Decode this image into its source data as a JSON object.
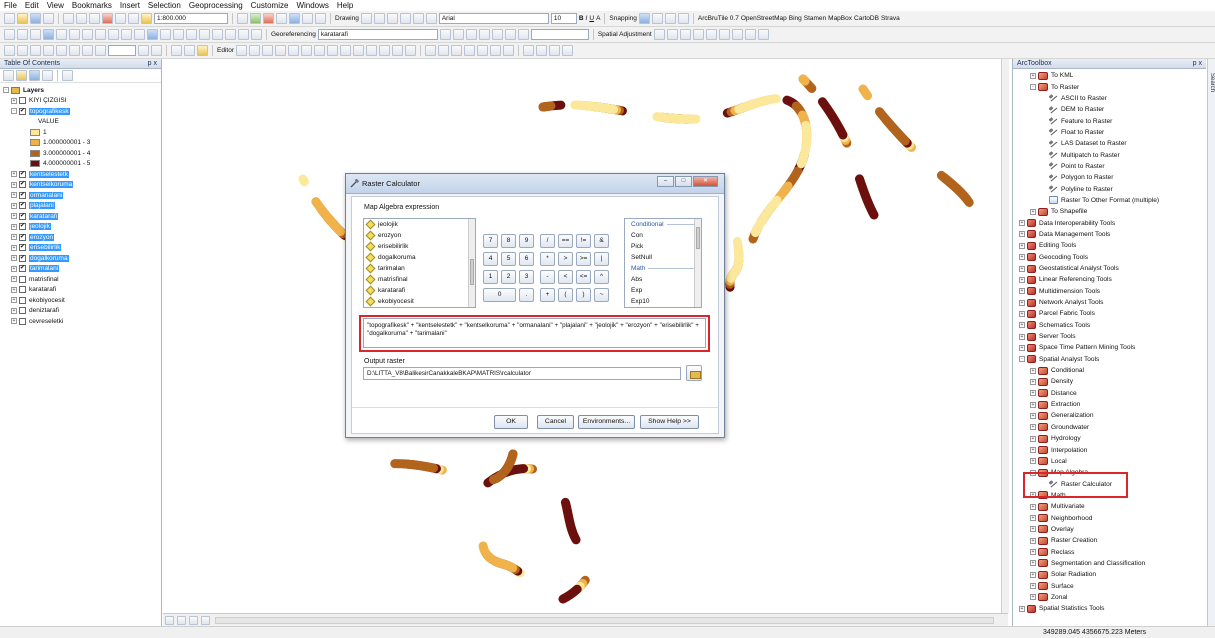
{
  "menu": [
    "File",
    "Edit",
    "View",
    "Bookmarks",
    "Insert",
    "Selection",
    "Geoprocessing",
    "Customize",
    "Windows",
    "Help"
  ],
  "toolbar": {
    "scale": "1:800.000",
    "drawing": "Drawing",
    "font": "Arial",
    "font_size": "10",
    "bold": "B",
    "italic": "I",
    "underline": "U",
    "text_color": "A",
    "snapping": "Snapping",
    "plugins": "ArcBruTile 0.7",
    "basemaps": [
      "OpenStreetMap",
      "Bing",
      "Stamen",
      "MapBox",
      "CartoDB",
      "Strava"
    ],
    "georeferencing": "Georeferencing",
    "georef_layer": "karatarafi",
    "spatial_adjustment": "Spatial Adjustment",
    "editor": "Editor"
  },
  "toc": {
    "title": "Table Of Contents",
    "pin": "p x",
    "root": "Layers",
    "layers": [
      {
        "name": "KIYI ÇIZGISI",
        "checked": false,
        "selected": false
      },
      {
        "name": "topografikesk",
        "checked": true,
        "selected": true
      },
      {
        "name": "kentselestetk",
        "checked": true,
        "selected": true
      },
      {
        "name": "kentselkoruma",
        "checked": true,
        "selected": true
      },
      {
        "name": "ormanalani",
        "checked": true,
        "selected": true
      },
      {
        "name": "plajalani",
        "checked": true,
        "selected": true
      },
      {
        "name": "karatarafi",
        "checked": true,
        "selected": true
      },
      {
        "name": "jeolojik",
        "checked": true,
        "selected": true
      },
      {
        "name": "erozyon",
        "checked": true,
        "selected": true
      },
      {
        "name": "erisebilirlik",
        "checked": true,
        "selected": true
      },
      {
        "name": "dogalkoruma",
        "checked": true,
        "selected": true
      },
      {
        "name": "tarimalani",
        "checked": true,
        "selected": true
      },
      {
        "name": "matrisfinal",
        "checked": false,
        "selected": false
      },
      {
        "name": "karatarafi",
        "checked": false,
        "selected": false
      },
      {
        "name": "ekobiyocesit",
        "checked": false,
        "selected": false
      },
      {
        "name": "deniztarafi",
        "checked": false,
        "selected": false
      },
      {
        "name": "cevreseletki",
        "checked": false,
        "selected": false
      }
    ],
    "legend_title": "VALUE",
    "legend": [
      {
        "label": "1",
        "color": "#fbe89a"
      },
      {
        "label": "1.000000001 - 3",
        "color": "#f0b24a"
      },
      {
        "label": "3.000000001 - 4",
        "color": "#b2631c"
      },
      {
        "label": "4.000000001 - 5",
        "color": "#6b0f0f"
      }
    ]
  },
  "dialog": {
    "title": "Raster Calculator",
    "win_min": "–",
    "win_max": "□",
    "win_close": "✕",
    "section_label": "Map Algebra expression",
    "layers": [
      "jeolojik",
      "erozyon",
      "erisebilirlik",
      "dogalkoruma",
      "tarimalan",
      "matrisfinal",
      "karatarafi",
      "ekobiyocesit"
    ],
    "keypad": [
      [
        "7",
        "8",
        "9",
        "/",
        "==",
        "!=",
        "&"
      ],
      [
        "4",
        "5",
        "6",
        "*",
        ">",
        ">=",
        "|"
      ],
      [
        "1",
        "2",
        "3",
        "-",
        "<",
        "<=",
        "^"
      ],
      [
        "0",
        ".",
        "+",
        "(",
        ")",
        "~"
      ]
    ],
    "func_group1": "Conditional",
    "func_items1": [
      "Con",
      "Pick",
      "SetNull"
    ],
    "func_group2": "Math",
    "func_items2": [
      "Abs",
      "Exp",
      "Exp10"
    ],
    "expression": "\"topografikesk\" + \"kentselestetk\" + \"kentselkoruma\" + \"ormanalani\" + \"plajalani\" + \"jeolojik\" + \"erozyon\" + \"erisebilirlik\" + \"dogalkoruma\" + \"tarimalani\"",
    "output_label": "Output raster",
    "output_path": "D:\\LITTA_V8\\BalikesirCanakkaleBKAP\\MATRIS\\rcalculator",
    "buttons": {
      "ok": "OK",
      "cancel": "Cancel",
      "environments": "Environments...",
      "help": "Show Help >>"
    }
  },
  "arctoolbox": {
    "title": "ArcToolbox",
    "pin": "p x",
    "items": [
      {
        "level": 1,
        "kind": "toolset",
        "label": "To KML",
        "exp": "+"
      },
      {
        "level": 1,
        "kind": "toolset",
        "label": "To Raster",
        "exp": "-"
      },
      {
        "level": 2,
        "kind": "tool",
        "label": "ASCII to Raster"
      },
      {
        "level": 2,
        "kind": "tool",
        "label": "DEM to Raster"
      },
      {
        "level": 2,
        "kind": "tool",
        "label": "Feature to Raster"
      },
      {
        "level": 2,
        "kind": "tool",
        "label": "Float to Raster"
      },
      {
        "level": 2,
        "kind": "tool",
        "label": "LAS Dataset to Raster"
      },
      {
        "level": 2,
        "kind": "tool",
        "label": "Multipatch to Raster"
      },
      {
        "level": 2,
        "kind": "tool",
        "label": "Point to Raster"
      },
      {
        "level": 2,
        "kind": "tool",
        "label": "Polygon to Raster"
      },
      {
        "level": 2,
        "kind": "tool",
        "label": "Polyline to Raster"
      },
      {
        "level": 2,
        "kind": "script",
        "label": "Raster To Other Format (multiple)"
      },
      {
        "level": 1,
        "kind": "toolset",
        "label": "To Shapefile",
        "exp": "+"
      },
      {
        "level": 0,
        "kind": "toolbox",
        "label": "Data Interoperability Tools",
        "exp": "+"
      },
      {
        "level": 0,
        "kind": "toolbox",
        "label": "Data Management Tools",
        "exp": "+"
      },
      {
        "level": 0,
        "kind": "toolbox",
        "label": "Editing Tools",
        "exp": "+"
      },
      {
        "level": 0,
        "kind": "toolbox",
        "label": "Geocoding Tools",
        "exp": "+"
      },
      {
        "level": 0,
        "kind": "toolbox",
        "label": "Geostatistical Analyst Tools",
        "exp": "+"
      },
      {
        "level": 0,
        "kind": "toolbox",
        "label": "Linear Referencing Tools",
        "exp": "+"
      },
      {
        "level": 0,
        "kind": "toolbox",
        "label": "Multidimension Tools",
        "exp": "+"
      },
      {
        "level": 0,
        "kind": "toolbox",
        "label": "Network Analyst Tools",
        "exp": "+"
      },
      {
        "level": 0,
        "kind": "toolbox",
        "label": "Parcel Fabric Tools",
        "exp": "+"
      },
      {
        "level": 0,
        "kind": "toolbox",
        "label": "Schematics Tools",
        "exp": "+"
      },
      {
        "level": 0,
        "kind": "toolbox",
        "label": "Server Tools",
        "exp": "+"
      },
      {
        "level": 0,
        "kind": "toolbox",
        "label": "Space Time Pattern Mining Tools",
        "exp": "+"
      },
      {
        "level": 0,
        "kind": "toolbox",
        "label": "Spatial Analyst Tools",
        "exp": "-"
      },
      {
        "level": 1,
        "kind": "toolset",
        "label": "Conditional",
        "exp": "+"
      },
      {
        "level": 1,
        "kind": "toolset",
        "label": "Density",
        "exp": "+"
      },
      {
        "level": 1,
        "kind": "toolset",
        "label": "Distance",
        "exp": "+"
      },
      {
        "level": 1,
        "kind": "toolset",
        "label": "Extraction",
        "exp": "+"
      },
      {
        "level": 1,
        "kind": "toolset",
        "label": "Generalization",
        "exp": "+"
      },
      {
        "level": 1,
        "kind": "toolset",
        "label": "Groundwater",
        "exp": "+"
      },
      {
        "level": 1,
        "kind": "toolset",
        "label": "Hydrology",
        "exp": "+"
      },
      {
        "level": 1,
        "kind": "toolset",
        "label": "Interpolation",
        "exp": "+"
      },
      {
        "level": 1,
        "kind": "toolset",
        "label": "Local",
        "exp": "+"
      },
      {
        "level": 1,
        "kind": "toolset",
        "label": "Map Algebra",
        "exp": "-"
      },
      {
        "level": 2,
        "kind": "tool",
        "label": "Raster Calculator"
      },
      {
        "level": 1,
        "kind": "toolset",
        "label": "Math",
        "exp": "+"
      },
      {
        "level": 1,
        "kind": "toolset",
        "label": "Multivariate",
        "exp": "+"
      },
      {
        "level": 1,
        "kind": "toolset",
        "label": "Neighborhood",
        "exp": "+"
      },
      {
        "level": 1,
        "kind": "toolset",
        "label": "Overlay",
        "exp": "+"
      },
      {
        "level": 1,
        "kind": "toolset",
        "label": "Raster Creation",
        "exp": "+"
      },
      {
        "level": 1,
        "kind": "toolset",
        "label": "Reclass",
        "exp": "+"
      },
      {
        "level": 1,
        "kind": "toolset",
        "label": "Segmentation and Classification",
        "exp": "+"
      },
      {
        "level": 1,
        "kind": "toolset",
        "label": "Solar Radiation",
        "exp": "+"
      },
      {
        "level": 1,
        "kind": "toolset",
        "label": "Surface",
        "exp": "+"
      },
      {
        "level": 1,
        "kind": "toolset",
        "label": "Zonal",
        "exp": "+"
      },
      {
        "level": 0,
        "kind": "toolbox",
        "label": "Spatial Statistics Tools",
        "exp": "+"
      }
    ]
  },
  "right_tab": "Search",
  "status": {
    "coords": "349289.045  4356675.223 Meters"
  },
  "colors": {
    "highlight": "#d8262b",
    "selection": "#3399ff",
    "class1": "#fbe89a",
    "class2": "#f0b24a",
    "class3": "#b2631c",
    "class4": "#6b0f0f"
  }
}
